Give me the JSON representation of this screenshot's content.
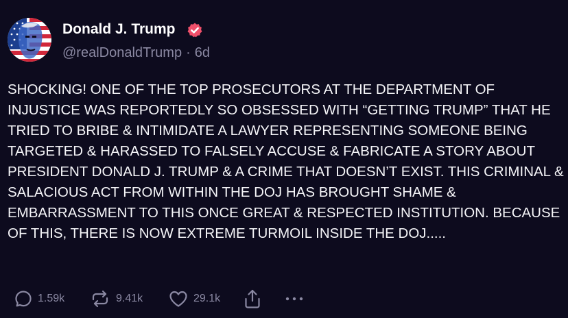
{
  "author": {
    "display_name": "Donald J. Trump",
    "handle": "@realDonaldTrump",
    "separator": "·",
    "age": "6d",
    "verified": true,
    "avatar_icon": "profile-avatar",
    "verified_icon": "verified-badge-icon"
  },
  "post": {
    "body": "SHOCKING! ONE OF THE TOP PROSECUTORS AT THE DEPARTMENT OF INJUSTICE WAS REPORTEDLY SO OBSESSED WITH “GETTING TRUMP” THAT HE TRIED TO BRIBE & INTIMIDATE A LAWYER REPRESENTING SOMEONE BEING TARGETED & HARASSED TO FALSELY ACCUSE & FABRICATE A STORY ABOUT PRESIDENT DONALD J. TRUMP & A CRIME THAT DOESN’T EXIST. THIS CRIMINAL & SALACIOUS ACT FROM WITHIN THE DOJ HAS BROUGHT SHAME & EMBARRASSMENT TO THIS ONCE GREAT & RESPECTED INSTITUTION. BECAUSE OF THIS, THERE IS NOW EXTREME TURMOIL INSIDE THE DOJ....."
  },
  "actions": {
    "replies": "1.59k",
    "retruths": "9.41k",
    "likes": "29.1k",
    "reply_icon": "reply-icon",
    "retruth_icon": "retruth-icon",
    "like_icon": "heart-icon",
    "share_icon": "share-icon",
    "more_icon": "more-icon"
  },
  "colors": {
    "background": "#0d0b1e",
    "text": "#f5f5f8",
    "muted": "#8b89a3",
    "verified_badge": "#f1506b"
  }
}
